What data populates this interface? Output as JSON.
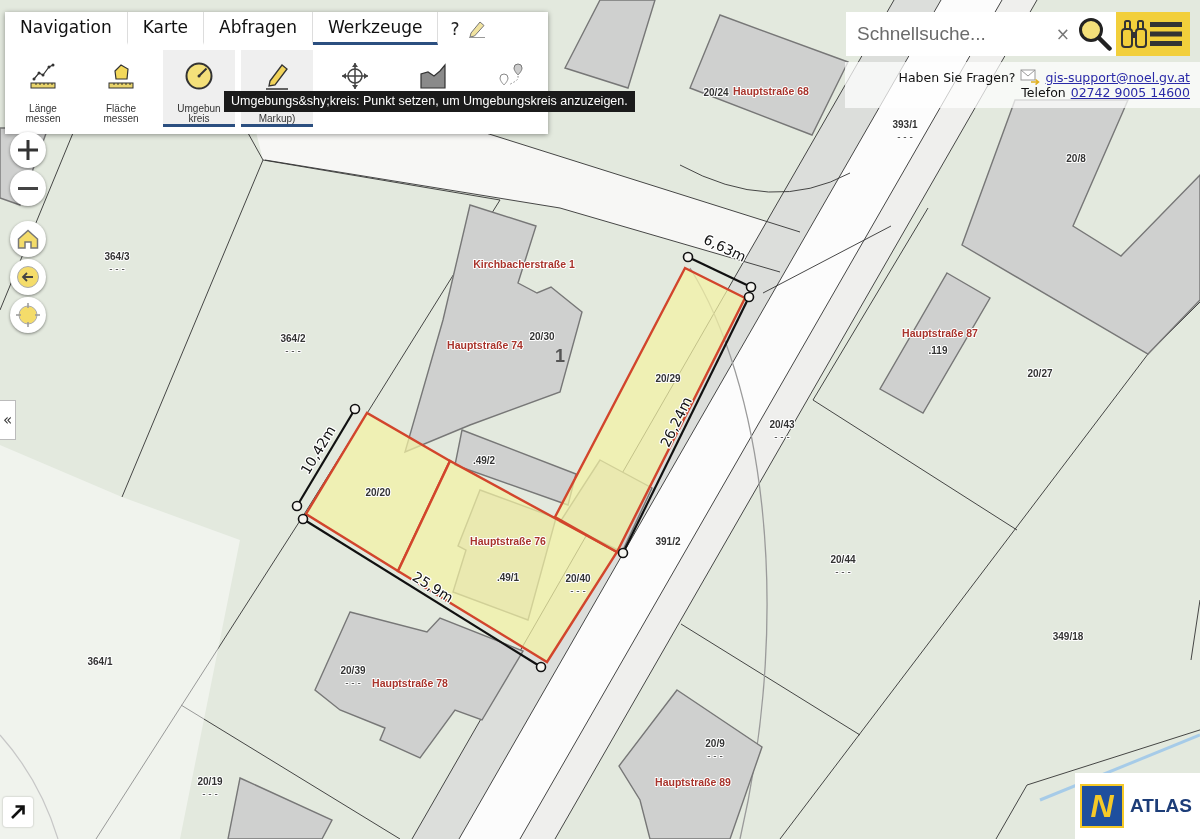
{
  "menu": {
    "tabs": [
      {
        "label": "Navigation",
        "selected": false
      },
      {
        "label": "Karte",
        "selected": false
      },
      {
        "label": "Abfragen",
        "selected": false
      },
      {
        "label": "Werkzeuge",
        "selected": true
      }
    ],
    "help": "?"
  },
  "tools": [
    {
      "kind": "length",
      "lines": [
        "Länge",
        "messen"
      ],
      "active": false
    },
    {
      "kind": "area",
      "lines": [
        "Fläche",
        "messen"
      ],
      "active": false
    },
    {
      "kind": "circle",
      "lines": [
        "Umgebun",
        "kreis"
      ],
      "active": true
    },
    {
      "kind": "markup",
      "lines": [
        "Markup)"
      ],
      "active": true
    },
    {
      "kind": "move",
      "active": false
    },
    {
      "kind": "profile",
      "active": false
    },
    {
      "kind": "route",
      "active": false
    }
  ],
  "tooltip": "Umgebungs&shy;kreis: Punkt setzen, um Umgebungskreis anzuzeigen.",
  "search": {
    "placeholder": "Schnellsuche...",
    "clear": "×"
  },
  "contact": {
    "question": "Haben Sie Fragen?",
    "email": "gis-support@noel.gv.at",
    "phone_label": "Telefon",
    "phone": "02742 9005 14600"
  },
  "map": {
    "parcels": [
      {
        "number": "20/24"
      },
      {
        "number": "393/1",
        "note": "- - -"
      },
      {
        "number": "20/8"
      },
      {
        "number": "364/3",
        "note": "- - -"
      },
      {
        "number": "364/2",
        "note": "- - -"
      },
      {
        "number": "20/30"
      },
      {
        "number": "20/29"
      },
      {
        "number": ".119"
      },
      {
        "number": "20/27"
      },
      {
        "number": "20/43",
        "note": "- - -"
      },
      {
        "number": ".49/2"
      },
      {
        "number": "20/20"
      },
      {
        "number": "391/2"
      },
      {
        "number": "20/44",
        "note": "- - -"
      },
      {
        "number": ".49/1"
      },
      {
        "number": "20/40",
        "note": "- - -"
      },
      {
        "number": "349/18"
      },
      {
        "number": "364/1"
      },
      {
        "number": "20/39",
        "note": "- - -"
      },
      {
        "number": "20/9",
        "note": "- - -"
      },
      {
        "number": "20/19",
        "note": "- - -"
      }
    ],
    "addresses": [
      "Hauptstraße 68",
      "Kirchbacherstraße 1",
      "Hauptstraße 74",
      "Hauptstraße 87",
      "Hauptstraße 76",
      "Hauptstraße 78",
      "Hauptstraße 89"
    ],
    "house_numbers": [
      "1"
    ],
    "measurements": [
      {
        "label": "6,63m"
      },
      {
        "label": "26,24m"
      },
      {
        "label": "10,42m"
      },
      {
        "label": "25,9m"
      }
    ]
  },
  "sidebar_toggle": "«",
  "logo": {
    "mark": "N",
    "name": "ATLAS"
  }
}
